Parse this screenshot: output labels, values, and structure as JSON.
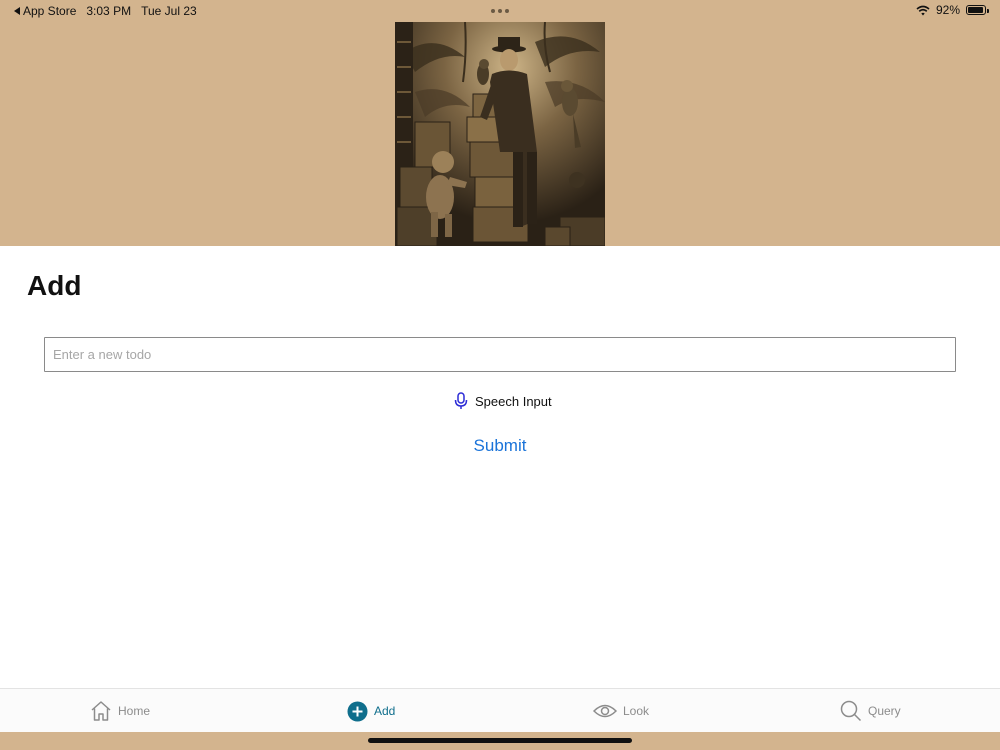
{
  "status_bar": {
    "back_app": "App Store",
    "time": "3:03 PM",
    "date": "Tue Jul 23",
    "battery": "92%",
    "battery_level": 0.92
  },
  "page": {
    "title": "Add"
  },
  "todo_input": {
    "placeholder": "Enter a new todo",
    "value": ""
  },
  "speech_button": {
    "label": "Speech Input",
    "icon": "microphone-icon"
  },
  "submit_button": {
    "label": "Submit"
  },
  "tabs": [
    {
      "label": "Home",
      "icon": "home-icon",
      "active": false
    },
    {
      "label": "Add",
      "icon": "plus-circle-icon",
      "active": true
    },
    {
      "label": "Look",
      "icon": "eye-icon",
      "active": false
    },
    {
      "label": "Query",
      "icon": "search-icon",
      "active": false
    }
  ],
  "colors": {
    "header_background": "#d3b48e",
    "active_tab": "#0f6e8c",
    "submit": "#1a73d9",
    "speech_icon": "#2b2bd6"
  }
}
